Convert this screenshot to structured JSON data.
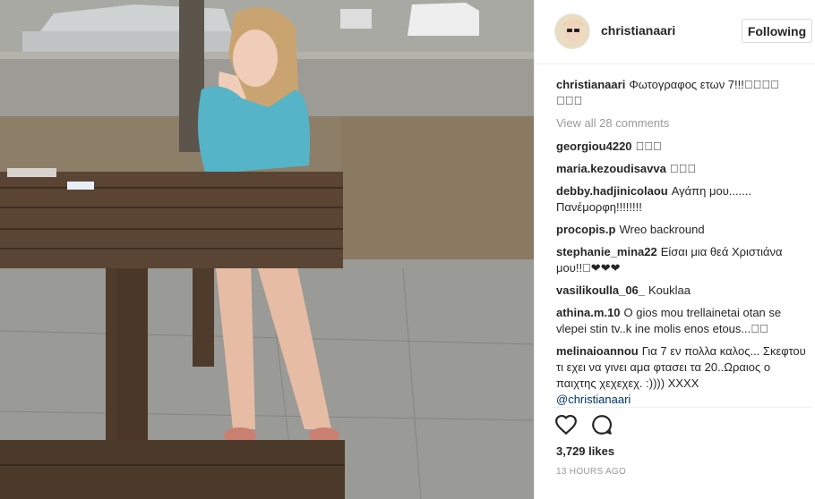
{
  "post": {
    "username": "christianaari",
    "follow_label": "Following",
    "caption_user": "christianaari",
    "caption_text": "Φωτογραφος ετων 7!!!􏿾􏿾􏿾􏿾 􏿾􏿾􏿾",
    "view_all": "View all 28 comments",
    "likes": "3,729 likes",
    "time": "13 HOURS AGO"
  },
  "comments": [
    {
      "user": "georgiou4220",
      "text": "􏿾􏿾􏿾"
    },
    {
      "user": "maria.kezoudisavva",
      "text": "􏿾􏿾􏿾"
    },
    {
      "user": "debby.hadjinicolaou",
      "text": "Αγάπη μου....... Πανέμορφη!!!!!!!!"
    },
    {
      "user": "procopis.p",
      "text": "Wreo backround"
    },
    {
      "user": "stephanie_mina22",
      "text": "Είσαι μια θεά Χριστιάνα μου!!􏿾❤❤❤"
    },
    {
      "user": "vasilikoulla_06_",
      "text": "Kouklaa"
    },
    {
      "user": "athina.m.10",
      "text": "O gios mou trellainetai otan se vlepei stin tv..k ine molis enos etous...􏿾􏿾"
    },
    {
      "user": "melinaioannou",
      "text": "Για 7 εν πολλα καλος... Σκεφτου τι εχει να γινει αμα φτασει τα 20..Ωραιος ο παιχτης χεχεχεχ. :)))) ΧΧΧΧ",
      "mention": "@christianaari"
    }
  ],
  "colors": {
    "text": "#262626",
    "muted": "#999999",
    "border": "#dbdbdb",
    "link": "#003569"
  },
  "icons": [
    "heart-icon",
    "comment-icon"
  ]
}
